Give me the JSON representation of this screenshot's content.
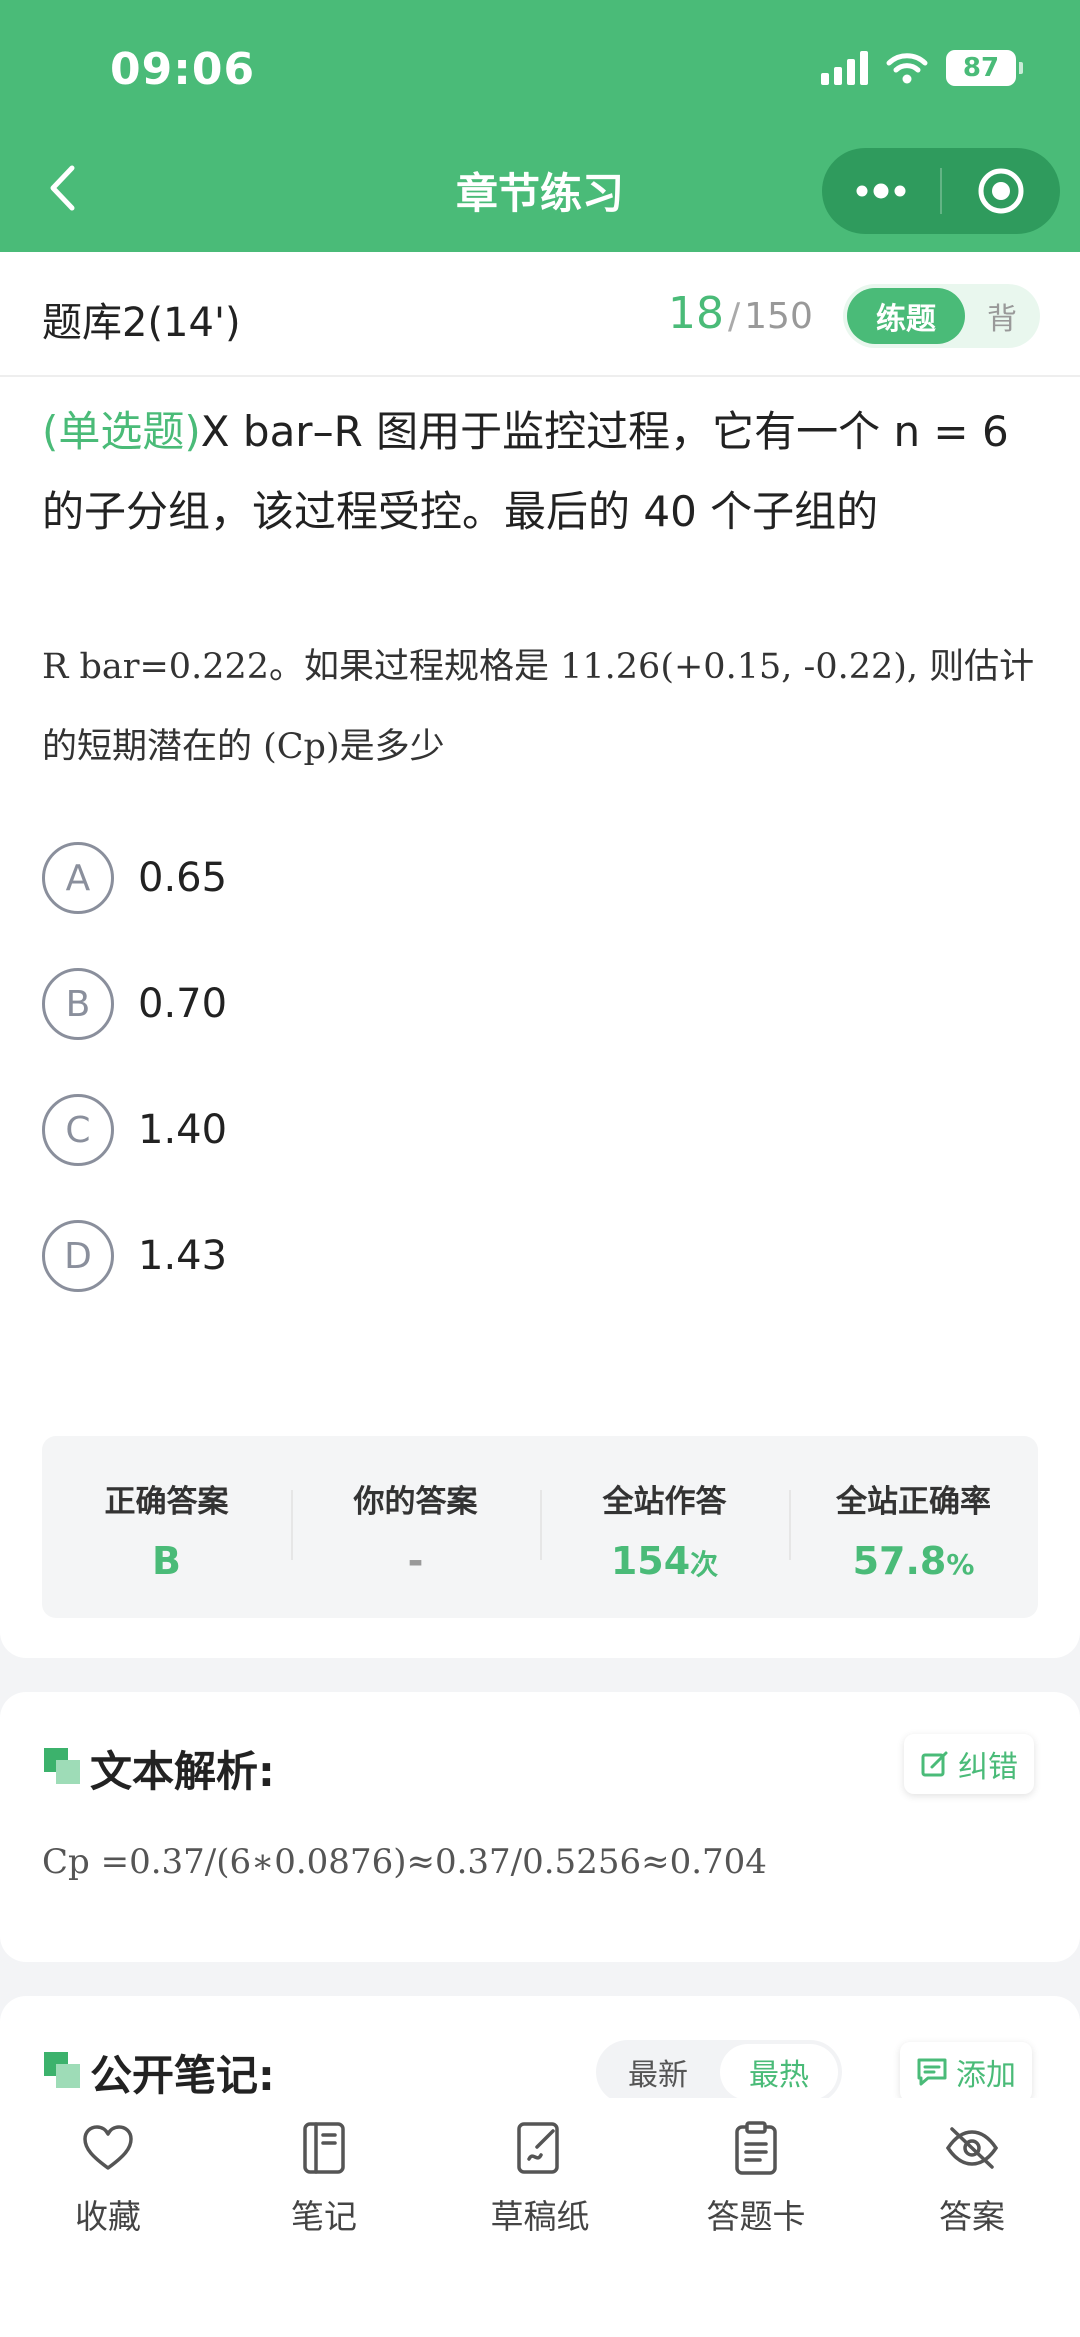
{
  "status_bar": {
    "time": "09:06",
    "battery": "87"
  },
  "nav": {
    "title": "章节练习"
  },
  "bank": {
    "name": "题库2(14')",
    "current": "18",
    "separator": "/",
    "total": "150",
    "mode_active": "练题",
    "mode_inactive": "背"
  },
  "question": {
    "type": "(单选题)",
    "text": "X bar–R 图用于监控过程，它有一个 n = 6 的子分组，该过程受控。最后的 40 个子组的",
    "text2": "R bar=0.222。如果过程规格是 11.26(+0.15, -0.22), 则估计的短期潜在的 (Cp)是多少"
  },
  "options": [
    {
      "letter": "A",
      "text": "0.65"
    },
    {
      "letter": "B",
      "text": "0.70"
    },
    {
      "letter": "C",
      "text": "1.40"
    },
    {
      "letter": "D",
      "text": "1.43"
    }
  ],
  "stats": [
    {
      "label": "正确答案",
      "value": "B",
      "unit": ""
    },
    {
      "label": "你的答案",
      "value": "-",
      "unit": ""
    },
    {
      "label": "全站作答",
      "value": "154",
      "unit": "次"
    },
    {
      "label": "全站正确率",
      "value": "57.8",
      "unit": "%"
    }
  ],
  "analysis": {
    "title": "文本解析:",
    "correct_label": "纠错",
    "content": "Cp =0.37/(6∗0.0876)≈0.37/0.5256≈0.704"
  },
  "notes": {
    "title": "公开笔记:",
    "sort_latest": "最新",
    "sort_hot": "最热",
    "add_label": "添加"
  },
  "bottom_tabs": [
    {
      "label": "收藏",
      "icon": "heart-icon"
    },
    {
      "label": "笔记",
      "icon": "notebook-icon"
    },
    {
      "label": "草稿纸",
      "icon": "draft-icon"
    },
    {
      "label": "答题卡",
      "icon": "answer-sheet-icon"
    },
    {
      "label": "答案",
      "icon": "eye-off-icon"
    }
  ],
  "colors": {
    "brand": "#4abb78",
    "brand_dark": "#2f9b5d"
  }
}
